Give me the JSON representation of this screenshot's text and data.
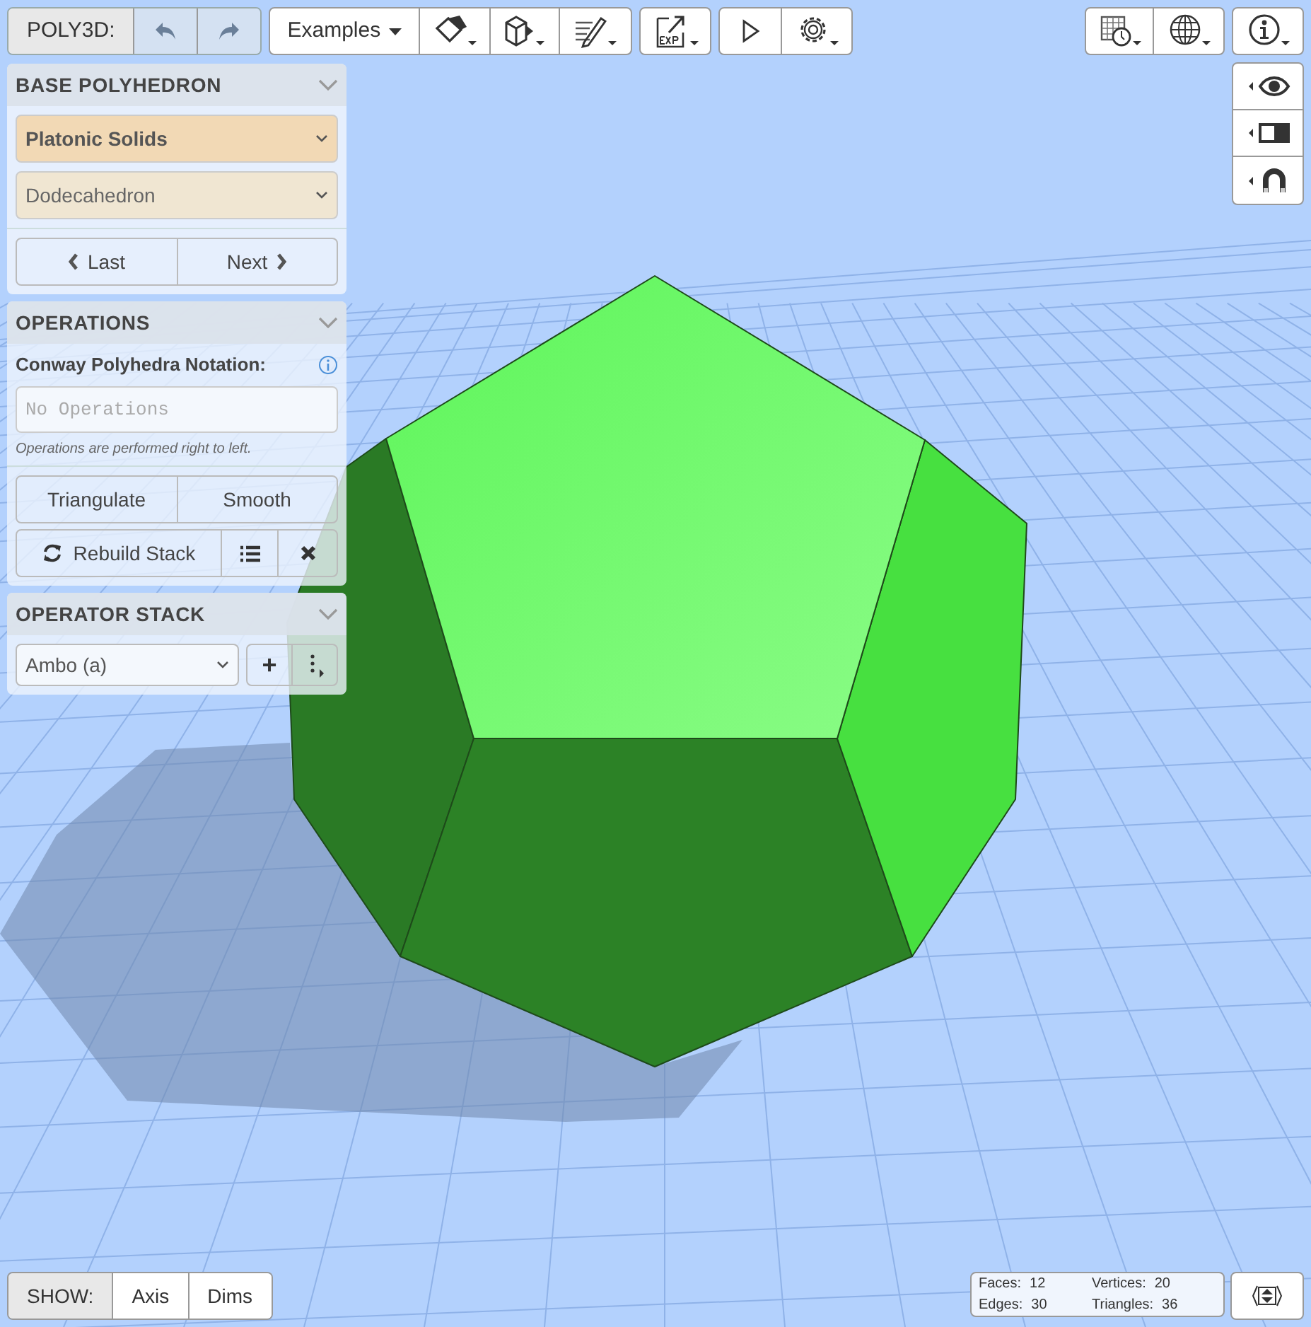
{
  "toolbar": {
    "app_label": "POLY3D:",
    "examples_label": "Examples"
  },
  "base_polyhedron": {
    "title": "BASE POLYHEDRON",
    "family": "Platonic Solids",
    "shape": "Dodecahedron",
    "last_label": "Last",
    "next_label": "Next"
  },
  "operations": {
    "title": "OPERATIONS",
    "notation_label": "Conway Polyhedra Notation:",
    "notation_placeholder": "No Operations",
    "hint": "Operations are performed right to left.",
    "triangulate_label": "Triangulate",
    "smooth_label": "Smooth",
    "rebuild_label": "Rebuild Stack"
  },
  "operator_stack": {
    "title": "OPERATOR STACK",
    "operator": "Ambo (a)",
    "add_label": "+"
  },
  "show_bar": {
    "label": "SHOW:",
    "options": [
      {
        "label": "Axis",
        "selected": false
      },
      {
        "label": "Dims",
        "selected": false
      }
    ]
  },
  "stats": [
    {
      "label": "Faces:",
      "value": "12"
    },
    {
      "label": "Vertices:",
      "value": "20"
    },
    {
      "label": "Edges:",
      "value": "30"
    },
    {
      "label": "Triangles:",
      "value": "36"
    }
  ]
}
